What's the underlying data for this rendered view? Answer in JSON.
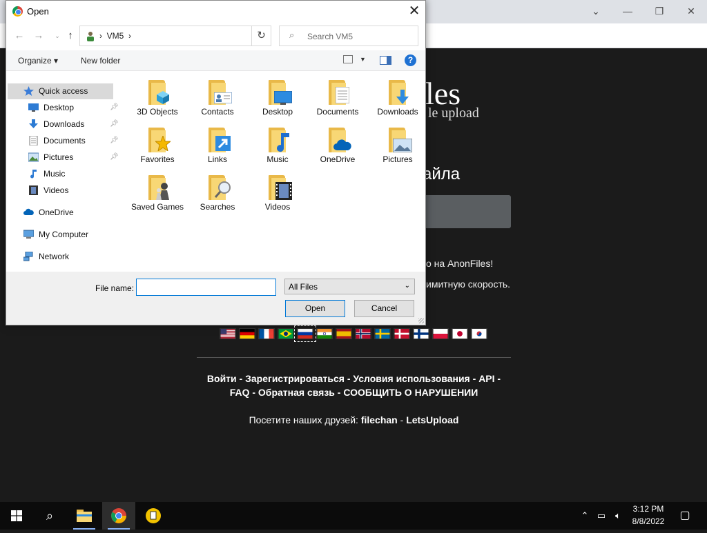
{
  "browser": {
    "controls": {
      "minimize": "—",
      "restore": "❐",
      "close": "✕",
      "chevron": "⌄"
    },
    "toolbar_icons": [
      "translate-icon",
      "share-icon",
      "star-icon",
      "sidebar-icon",
      "profile-icon",
      "menu-icon"
    ]
  },
  "page": {
    "logo_tail": "les",
    "logo_subtitle": "le upload",
    "upload_heading": "айла",
    "line1": "о на AnonFiles!",
    "line2": "имитную скорость.",
    "flags": [
      "us",
      "de",
      "fr",
      "br",
      "ru",
      "in",
      "es",
      "no",
      "se",
      "dk",
      "fi",
      "pl",
      "jp",
      "kr"
    ],
    "selected_flag": "ru",
    "links_line1": {
      "login": "Войти",
      "register": "Зарегистрироваться",
      "terms": "Условия использования",
      "api": "API",
      "sep": " - "
    },
    "links_line2": {
      "faq": "FAQ",
      "feedback": "Обратная связь",
      "report": "СООБЩИТЬ О НАРУШЕНИИ",
      "sep": " - "
    },
    "friends": {
      "prefix": "Посетите наших друзей: ",
      "friend1": "filechan",
      "sep": " - ",
      "friend2": "LetsUpload"
    }
  },
  "dialog": {
    "title": "Open",
    "address": {
      "sep1": "›",
      "location": "VM5",
      "sep2": "›"
    },
    "search_placeholder": "Search VM5",
    "organize_label": "Organize ▾",
    "new_folder_label": "New folder",
    "help_label": "?",
    "sidebar": {
      "quick_access": "Quick access",
      "items": [
        {
          "label": "Desktop",
          "pinned": true
        },
        {
          "label": "Downloads",
          "pinned": true
        },
        {
          "label": "Documents",
          "pinned": true
        },
        {
          "label": "Pictures",
          "pinned": true
        },
        {
          "label": "Music",
          "pinned": false
        },
        {
          "label": "Videos",
          "pinned": false
        }
      ],
      "onedrive": "OneDrive",
      "my_computer": "My Computer",
      "network": "Network"
    },
    "folders": [
      {
        "label": "3D Objects",
        "icon": "cube-icon"
      },
      {
        "label": "Contacts",
        "icon": "contact-card-icon"
      },
      {
        "label": "Desktop",
        "icon": "monitor-icon"
      },
      {
        "label": "Documents",
        "icon": "document-icon"
      },
      {
        "label": "Downloads",
        "icon": "download-arrow-icon"
      },
      {
        "label": "Favorites",
        "icon": "star-icon"
      },
      {
        "label": "Links",
        "icon": "link-arrow-icon"
      },
      {
        "label": "Music",
        "icon": "music-note-icon"
      },
      {
        "label": "OneDrive",
        "icon": "cloud-icon"
      },
      {
        "label": "Pictures",
        "icon": "picture-icon"
      },
      {
        "label": "Saved Games",
        "icon": "chess-icon"
      },
      {
        "label": "Searches",
        "icon": "magnifier-icon"
      },
      {
        "label": "Videos",
        "icon": "film-icon"
      }
    ],
    "file_name_label": "File name:",
    "file_name_value": "",
    "file_type": "All Files",
    "open_label": "Open",
    "cancel_label": "Cancel"
  },
  "taskbar": {
    "apps": [
      "start-icon",
      "search-icon",
      "file-explorer-icon",
      "chrome-icon",
      "sticky-app-icon"
    ],
    "time": "3:12 PM",
    "date": "8/8/2022"
  }
}
